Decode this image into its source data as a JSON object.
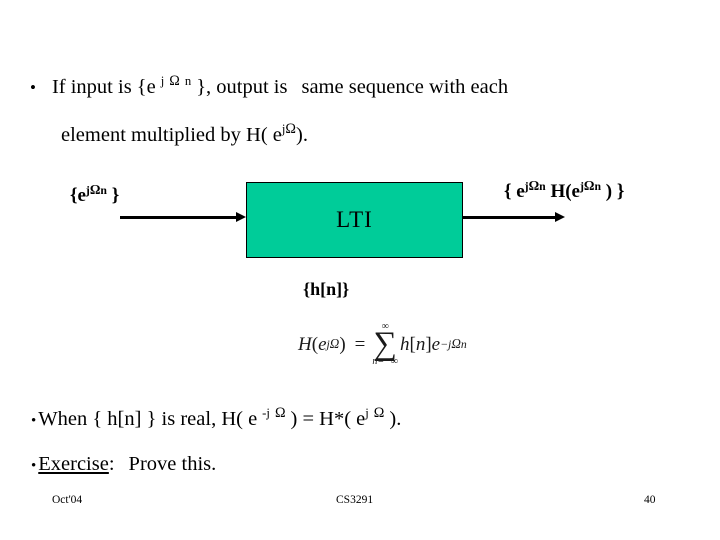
{
  "slide": {
    "bullet_1": {
      "bullet_char": "•",
      "line1_part1": "If  input  is  {e",
      "line1_sup_j": "j",
      "line1_sup_omega": "Ω",
      "line1_sup_n": "n",
      "line1_part2": "},  output  is",
      "line1_part3": "same  sequence  with  each",
      "line2_part1": "element multiplied by H( e",
      "line2_sup_j": "j",
      "line2_sup_omega": "Ω",
      "line2_part2": ")."
    },
    "diagram": {
      "input_label_prefix": "{e",
      "input_label_sup_j": "j",
      "input_label_sup_omega": "Ω",
      "input_label_sup_n": "n",
      "input_label_suffix": " }",
      "box_label": "LTI",
      "box_color": "#00cc99",
      "box_border_color": "#000000",
      "output_label_p1": "{ e",
      "output_label_sup1_j": "j",
      "output_label_sup1_omega": "Ω",
      "output_label_sup1_n": "n",
      "output_label_p2": " H(e",
      "output_label_sup2_j": "j",
      "output_label_sup2_omega": "Ω",
      "output_label_sup2_n": "n",
      "output_label_p3": " ) }",
      "impulse_response_label": "{h[n]}",
      "input_arrow_name": "input-arrow",
      "output_arrow_name": "output-arrow"
    },
    "equation": {
      "lhs_H": "H",
      "lhs_open": "(",
      "lhs_e": "e",
      "lhs_sup_j": "j",
      "lhs_sup_omega": "Ω",
      "lhs_close": ")",
      "equals": "=",
      "sigma_upper": "∞",
      "sigma_glyph": "∑",
      "sigma_lower": "n=−∞",
      "rhs_h": "h",
      "rhs_bracket_open": "[",
      "rhs_n": "n",
      "rhs_bracket_close": "]",
      "rhs_e": "e",
      "rhs_sup_minus": "−",
      "rhs_sup_j": "j",
      "rhs_sup_omega": "Ω",
      "rhs_sup_n": "n"
    },
    "bullet_2": {
      "bullet_char": "•",
      "part1": "When { h[n] } is real,  H( e",
      "sup1_minus_j": "-j",
      "sup1_omega": "Ω",
      "part2": ") =  H*( e",
      "sup2_j": "j",
      "sup2_omega": "Ω",
      "part3": ")."
    },
    "bullet_3": {
      "bullet_char": "•",
      "label": "Exercise",
      "colon": ":",
      "text": "Prove this."
    },
    "footer": {
      "date": "Oct'04",
      "course": "CS3291",
      "page_number": "40"
    }
  }
}
